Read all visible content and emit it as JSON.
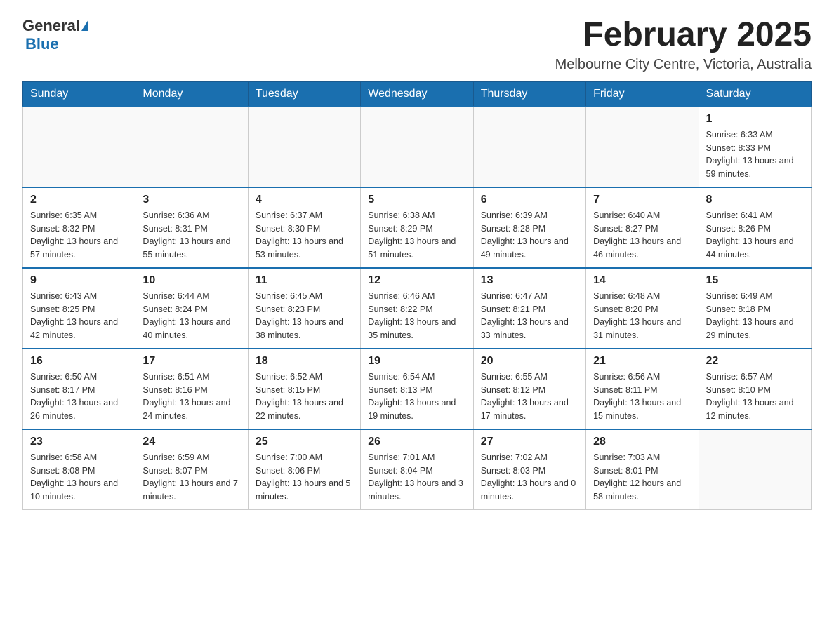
{
  "logo": {
    "general": "General",
    "blue": "Blue"
  },
  "title": "February 2025",
  "subtitle": "Melbourne City Centre, Victoria, Australia",
  "days_header": [
    "Sunday",
    "Monday",
    "Tuesday",
    "Wednesday",
    "Thursday",
    "Friday",
    "Saturday"
  ],
  "weeks": [
    [
      {
        "day": "",
        "info": ""
      },
      {
        "day": "",
        "info": ""
      },
      {
        "day": "",
        "info": ""
      },
      {
        "day": "",
        "info": ""
      },
      {
        "day": "",
        "info": ""
      },
      {
        "day": "",
        "info": ""
      },
      {
        "day": "1",
        "info": "Sunrise: 6:33 AM\nSunset: 8:33 PM\nDaylight: 13 hours and 59 minutes."
      }
    ],
    [
      {
        "day": "2",
        "info": "Sunrise: 6:35 AM\nSunset: 8:32 PM\nDaylight: 13 hours and 57 minutes."
      },
      {
        "day": "3",
        "info": "Sunrise: 6:36 AM\nSunset: 8:31 PM\nDaylight: 13 hours and 55 minutes."
      },
      {
        "day": "4",
        "info": "Sunrise: 6:37 AM\nSunset: 8:30 PM\nDaylight: 13 hours and 53 minutes."
      },
      {
        "day": "5",
        "info": "Sunrise: 6:38 AM\nSunset: 8:29 PM\nDaylight: 13 hours and 51 minutes."
      },
      {
        "day": "6",
        "info": "Sunrise: 6:39 AM\nSunset: 8:28 PM\nDaylight: 13 hours and 49 minutes."
      },
      {
        "day": "7",
        "info": "Sunrise: 6:40 AM\nSunset: 8:27 PM\nDaylight: 13 hours and 46 minutes."
      },
      {
        "day": "8",
        "info": "Sunrise: 6:41 AM\nSunset: 8:26 PM\nDaylight: 13 hours and 44 minutes."
      }
    ],
    [
      {
        "day": "9",
        "info": "Sunrise: 6:43 AM\nSunset: 8:25 PM\nDaylight: 13 hours and 42 minutes."
      },
      {
        "day": "10",
        "info": "Sunrise: 6:44 AM\nSunset: 8:24 PM\nDaylight: 13 hours and 40 minutes."
      },
      {
        "day": "11",
        "info": "Sunrise: 6:45 AM\nSunset: 8:23 PM\nDaylight: 13 hours and 38 minutes."
      },
      {
        "day": "12",
        "info": "Sunrise: 6:46 AM\nSunset: 8:22 PM\nDaylight: 13 hours and 35 minutes."
      },
      {
        "day": "13",
        "info": "Sunrise: 6:47 AM\nSunset: 8:21 PM\nDaylight: 13 hours and 33 minutes."
      },
      {
        "day": "14",
        "info": "Sunrise: 6:48 AM\nSunset: 8:20 PM\nDaylight: 13 hours and 31 minutes."
      },
      {
        "day": "15",
        "info": "Sunrise: 6:49 AM\nSunset: 8:18 PM\nDaylight: 13 hours and 29 minutes."
      }
    ],
    [
      {
        "day": "16",
        "info": "Sunrise: 6:50 AM\nSunset: 8:17 PM\nDaylight: 13 hours and 26 minutes."
      },
      {
        "day": "17",
        "info": "Sunrise: 6:51 AM\nSunset: 8:16 PM\nDaylight: 13 hours and 24 minutes."
      },
      {
        "day": "18",
        "info": "Sunrise: 6:52 AM\nSunset: 8:15 PM\nDaylight: 13 hours and 22 minutes."
      },
      {
        "day": "19",
        "info": "Sunrise: 6:54 AM\nSunset: 8:13 PM\nDaylight: 13 hours and 19 minutes."
      },
      {
        "day": "20",
        "info": "Sunrise: 6:55 AM\nSunset: 8:12 PM\nDaylight: 13 hours and 17 minutes."
      },
      {
        "day": "21",
        "info": "Sunrise: 6:56 AM\nSunset: 8:11 PM\nDaylight: 13 hours and 15 minutes."
      },
      {
        "day": "22",
        "info": "Sunrise: 6:57 AM\nSunset: 8:10 PM\nDaylight: 13 hours and 12 minutes."
      }
    ],
    [
      {
        "day": "23",
        "info": "Sunrise: 6:58 AM\nSunset: 8:08 PM\nDaylight: 13 hours and 10 minutes."
      },
      {
        "day": "24",
        "info": "Sunrise: 6:59 AM\nSunset: 8:07 PM\nDaylight: 13 hours and 7 minutes."
      },
      {
        "day": "25",
        "info": "Sunrise: 7:00 AM\nSunset: 8:06 PM\nDaylight: 13 hours and 5 minutes."
      },
      {
        "day": "26",
        "info": "Sunrise: 7:01 AM\nSunset: 8:04 PM\nDaylight: 13 hours and 3 minutes."
      },
      {
        "day": "27",
        "info": "Sunrise: 7:02 AM\nSunset: 8:03 PM\nDaylight: 13 hours and 0 minutes."
      },
      {
        "day": "28",
        "info": "Sunrise: 7:03 AM\nSunset: 8:01 PM\nDaylight: 12 hours and 58 minutes."
      },
      {
        "day": "",
        "info": ""
      }
    ]
  ]
}
